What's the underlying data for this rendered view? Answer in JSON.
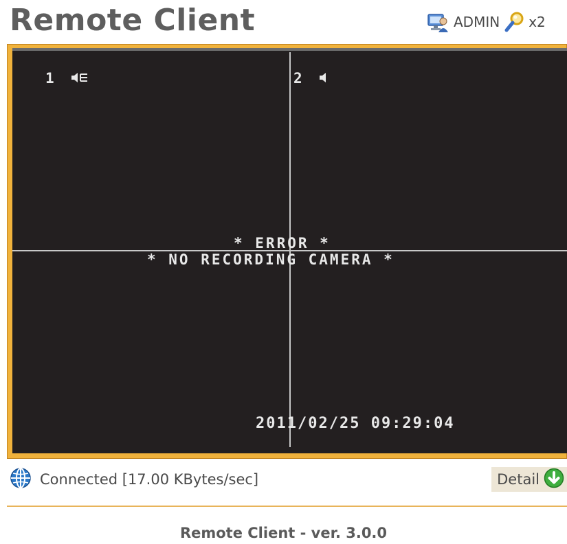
{
  "header": {
    "title": "Remote Client",
    "user_name": "ADMIN",
    "zoom_level": "x2",
    "user_icon": "user-monitor-icon",
    "zoom_icon": "magnifier-icon"
  },
  "video": {
    "channels": [
      {
        "number": "1",
        "audio_icon": "speaker-on-icon"
      },
      {
        "number": "2",
        "audio_icon": "speaker-off-icon"
      }
    ],
    "error_title": "* ERROR *",
    "error_message": "* NO RECORDING CAMERA *",
    "timestamp": "2011/02/25 09:29:04"
  },
  "status": {
    "icon": "globe-icon",
    "text": "Connected [17.00 KBytes/sec]",
    "detail_label": "Detail",
    "detail_icon": "down-arrow-icon"
  },
  "footer": {
    "version_text": "Remote Client - ver. 3.0.0"
  },
  "colors": {
    "frame": "#f0b23c",
    "screen": "#231f20",
    "title_text": "#5e5e5e",
    "detail_icon": "#3fae3f",
    "globe_icon": "#2a78c8"
  }
}
